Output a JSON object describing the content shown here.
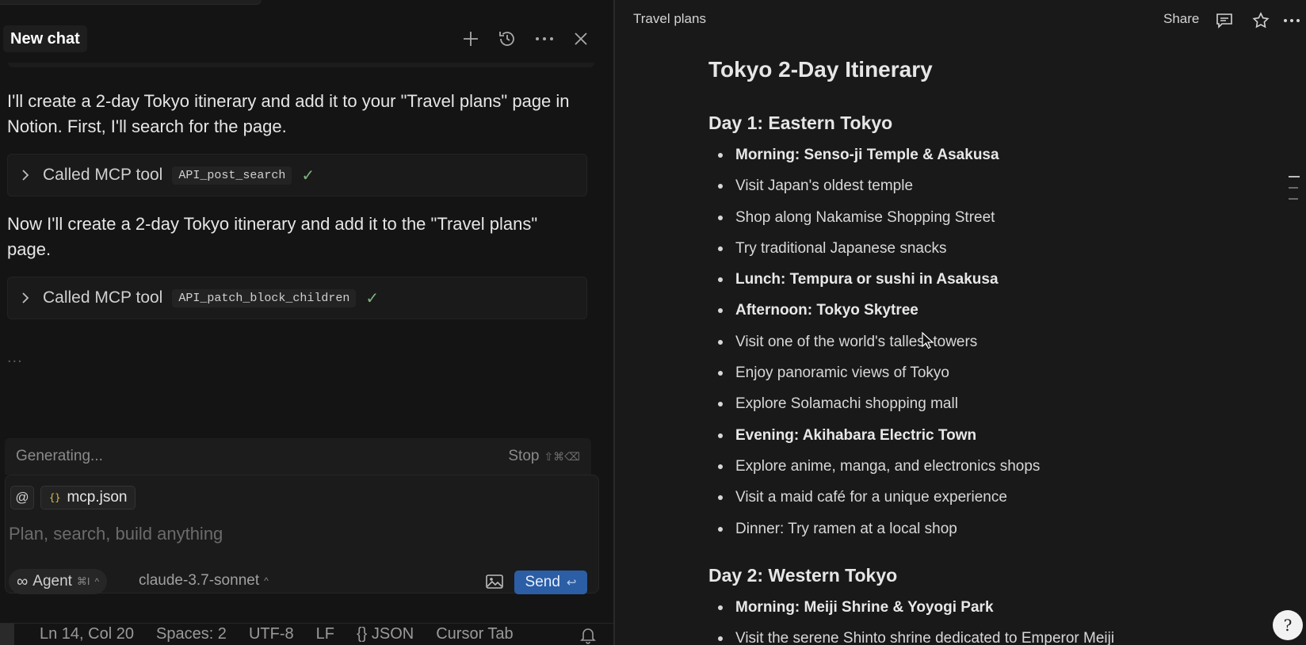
{
  "chat": {
    "title": "New chat",
    "messages": [
      "I'll create a 2-day Tokyo itinerary and add it to your \"Travel plans\" page in Notion. First, I'll search for the page.",
      "Now I'll create a 2-day Tokyo itinerary and add it to the \"Travel plans\" page."
    ],
    "tool_calls": [
      {
        "label": "Called MCP tool",
        "code": "API_post_search",
        "status": "✓"
      },
      {
        "label": "Called MCP tool",
        "code": "API_patch_block_children",
        "status": "✓"
      }
    ],
    "ellipsis": "...",
    "generating": "Generating...",
    "stop_label": "Stop",
    "stop_keys": "⇧⌘⌫",
    "composer": {
      "at": "@",
      "file_braces": "{}",
      "file_name": "mcp.json",
      "placeholder": "Plan, search, build anything",
      "agent_icon": "∞",
      "agent_label": "Agent",
      "agent_kbd": "⌘I",
      "model": "claude-3.7-sonnet",
      "send_label": "Send",
      "send_icon": "↩"
    }
  },
  "statusbar": {
    "items": [
      "Ln 14, Col 20",
      "Spaces: 2",
      "UTF-8",
      "LF",
      "{} JSON",
      "Cursor Tab"
    ]
  },
  "notion": {
    "breadcrumb": "Travel plans",
    "share_label": "Share",
    "title": "Tokyo 2-Day Itinerary",
    "day1": {
      "heading": "Day 1: Eastern Tokyo",
      "items": [
        {
          "text": "Morning: Senso-ji Temple & Asakusa",
          "bold": true
        },
        {
          "text": "Visit Japan's oldest temple",
          "bold": false
        },
        {
          "text": "Shop along Nakamise Shopping Street",
          "bold": false
        },
        {
          "text": "Try traditional Japanese snacks",
          "bold": false
        },
        {
          "text": "Lunch: Tempura or sushi in Asakusa",
          "bold": true
        },
        {
          "text": "Afternoon: Tokyo Skytree",
          "bold": true
        },
        {
          "text": "Visit one of the world's tallest towers",
          "bold": false
        },
        {
          "text": "Enjoy panoramic views of Tokyo",
          "bold": false
        },
        {
          "text": "Explore Solamachi shopping mall",
          "bold": false
        },
        {
          "text": "Evening: Akihabara Electric Town",
          "bold": true
        },
        {
          "text": "Explore anime, manga, and electronics shops",
          "bold": false
        },
        {
          "text": "Visit a maid café for a unique experience",
          "bold": false
        },
        {
          "text": "Dinner: Try ramen at a local shop",
          "bold": false
        }
      ]
    },
    "day2": {
      "heading": "Day 2: Western Tokyo",
      "items": [
        {
          "text": "Morning: Meiji Shrine & Yoyogi Park",
          "bold": true
        },
        {
          "text": "Visit the serene Shinto shrine dedicated to Emperor Meiji",
          "bold": false
        }
      ]
    },
    "help_glyph": "?"
  },
  "colors": {
    "accent_send": "#2b5ea5",
    "check_green": "#7fb27f",
    "background": "#191919"
  }
}
